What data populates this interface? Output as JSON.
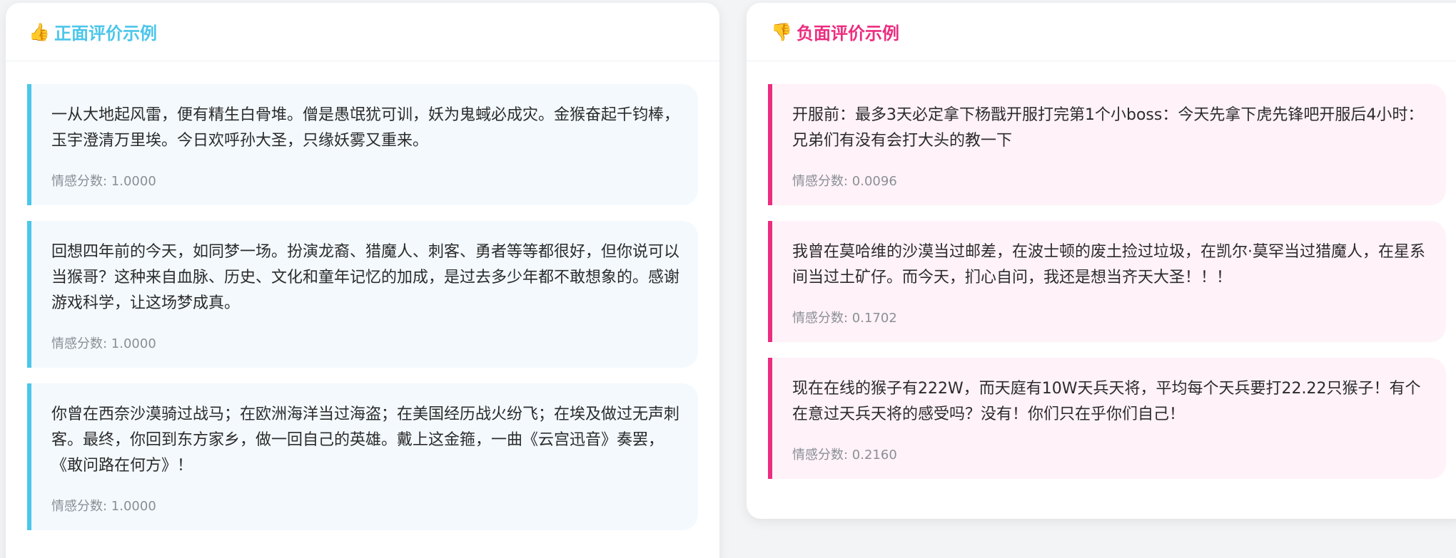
{
  "positive": {
    "title": "正面评价示例",
    "icon": "thumbs-up-icon",
    "accent": "#4cc6ea",
    "cards": [
      {
        "text": "一从大地起风雷，便有精生白骨堆。僧是愚氓犹可训，妖为鬼蜮必成灾。金猴奋起千钧棒，玉宇澄清万里埃。今日欢呼孙大圣，只缘妖雾又重来。",
        "score_label": "情感分数: ",
        "score": "1.0000"
      },
      {
        "text": "回想四年前的今天，如同梦一场。扮演龙裔、猎魔人、刺客、勇者等等都很好，但你说可以当猴哥？这种来自血脉、历史、文化和童年记忆的加成，是过去多少年都不敢想象的。感谢游戏科学，让这场梦成真。",
        "score_label": "情感分数: ",
        "score": "1.0000"
      },
      {
        "text": "你曾在西奈沙漠骑过战马；在欧洲海洋当过海盗；在美国经历战火纷飞；在埃及做过无声刺客。最终，你回到东方家乡，做一回自己的英雄。戴上这金箍，一曲《云宫迅音》奏罢，《敢问路在何方》！",
        "score_label": "情感分数: ",
        "score": "1.0000"
      }
    ]
  },
  "negative": {
    "title": "负面评价示例",
    "icon": "thumbs-down-icon",
    "accent": "#ec2d7f",
    "cards": [
      {
        "text": "开服前：最多3天必定拿下杨戬开服打完第1个小boss：今天先拿下虎先锋吧开服后4小时：兄弟们有没有会打大头的教一下",
        "score_label": "情感分数: ",
        "score": "0.0096"
      },
      {
        "text": "我曾在莫哈维的沙漠当过邮差，在波士顿的废土捡过垃圾，在凯尔·莫罕当过猎魔人，在星系间当过土矿仔。而今天，扪心自问，我还是想当齐天大圣！！！",
        "score_label": "情感分数: ",
        "score": "0.1702"
      },
      {
        "text": "现在在线的猴子有222W，而天庭有10W天兵天将，平均每个天兵要打22.22只猴子！有个在意过天兵天将的感受吗？没有！你们只在乎你们自己！",
        "score_label": "情感分数: ",
        "score": "0.2160"
      }
    ]
  }
}
